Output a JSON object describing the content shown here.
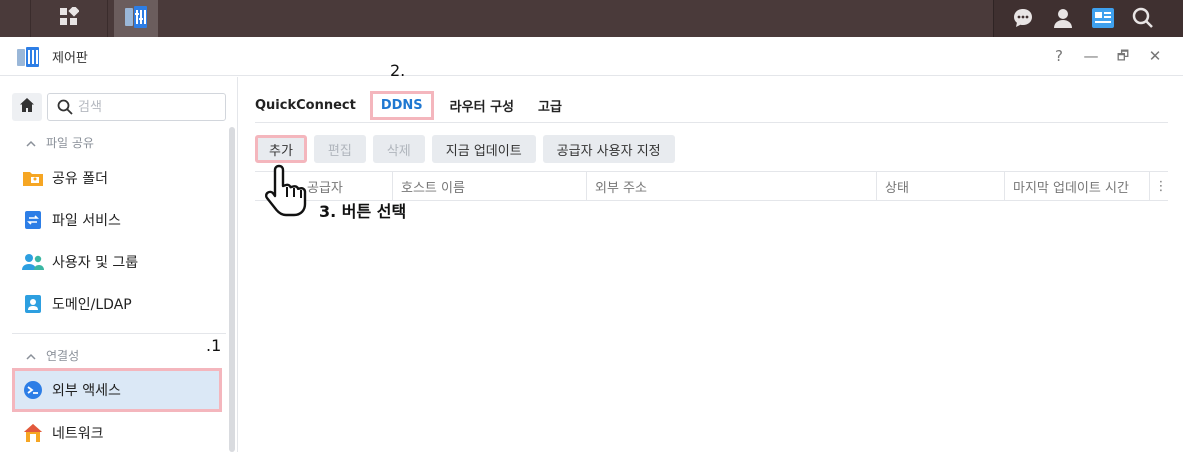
{
  "taskbar": {
    "main_menu_icon": "grid-icon",
    "control_panel_icon": "control-panel-icon",
    "right_icons": [
      "chat-icon",
      "user-icon",
      "widgets-icon",
      "search-icon"
    ]
  },
  "window": {
    "title": "제어판",
    "controls": {
      "help": "?",
      "minimize": "—",
      "maximize": "🗗",
      "close": "✕"
    }
  },
  "sidebar": {
    "search_placeholder": "검색",
    "section_file_sharing": "파일 공유",
    "items_file": [
      {
        "label": "공유 폴더",
        "icon": "shared-folder-icon"
      },
      {
        "label": "파일 서비스",
        "icon": "file-services-icon"
      },
      {
        "label": "사용자 및 그룹",
        "icon": "users-groups-icon"
      },
      {
        "label": "도메인/LDAP",
        "icon": "domain-ldap-icon"
      }
    ],
    "section_connectivity": "연결성",
    "items_conn": [
      {
        "label": "외부 액세스",
        "icon": "external-access-icon"
      },
      {
        "label": "네트워크",
        "icon": "network-icon"
      }
    ]
  },
  "tabs": [
    "QuickConnect",
    "DDNS",
    "라우터 구성",
    "고급"
  ],
  "toolbar": {
    "add": "추가",
    "edit": "편집",
    "delete": "삭제",
    "update_now": "지금 업데이트",
    "custom_provider": "공급자 사용자 지정"
  },
  "grid": {
    "columns": [
      "공급자",
      "호스트 이름",
      "외부 주소",
      "상태",
      "마지막 업데이트 시간"
    ]
  },
  "annotations": {
    "step1": ".1",
    "step2": "2.",
    "step3": "3. 버튼 선택"
  },
  "colors": {
    "accent": "#1f78d1",
    "highlight": "#f4b6bd",
    "taskbar": "#4a3a3a"
  }
}
